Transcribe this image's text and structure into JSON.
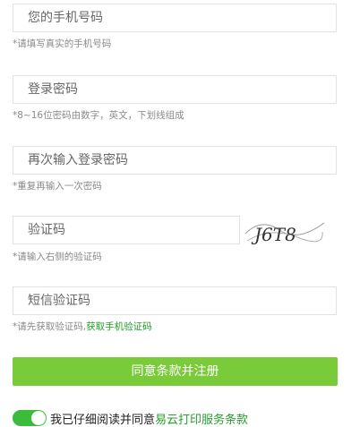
{
  "fields": {
    "phone": {
      "placeholder": "您的手机号码",
      "hint": "*请填写真实的手机号码"
    },
    "password": {
      "placeholder": "登录密码",
      "hint": "*8~16位密码由数字，英文，下划线组成"
    },
    "confirm": {
      "placeholder": "再次输入登录密码",
      "hint": "*重复再输入一次密码"
    },
    "captcha": {
      "placeholder": "验证码",
      "hint": "*请输入右侧的验证码",
      "image_text": "J6T8"
    },
    "sms": {
      "placeholder": "短信验证码",
      "hint_prefix": "*请先获取验证码,",
      "link": "获取手机验证码"
    }
  },
  "submit_label": "同意条款并注册",
  "agreement": {
    "prefix": "我已仔细阅读并同意",
    "terms": "易云打印服务条款",
    "checked": true
  },
  "colors": {
    "accent": "#7acb3a",
    "link": "#22a02a",
    "toggle": "#3bbd3b"
  }
}
